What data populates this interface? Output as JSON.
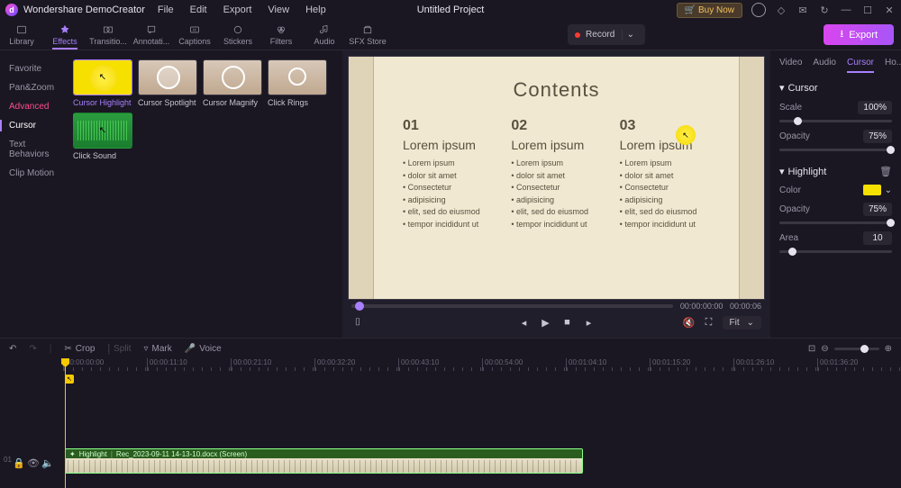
{
  "app": {
    "name": "Wondershare DemoCreator",
    "project": "Untitled Project"
  },
  "menu": [
    "File",
    "Edit",
    "Export",
    "View",
    "Help"
  ],
  "titlebar": {
    "buy": "🛒 Buy Now"
  },
  "tabs": [
    {
      "id": "library",
      "label": "Library"
    },
    {
      "id": "effects",
      "label": "Effects"
    },
    {
      "id": "transitions",
      "label": "Transitio..."
    },
    {
      "id": "annotations",
      "label": "Annotati..."
    },
    {
      "id": "captions",
      "label": "Captions"
    },
    {
      "id": "stickers",
      "label": "Stickers"
    },
    {
      "id": "filters",
      "label": "Filters"
    },
    {
      "id": "audio",
      "label": "Audio"
    },
    {
      "id": "sfx",
      "label": "SFX Store"
    }
  ],
  "record_label": "Record",
  "export_label": "Export",
  "sidebar": [
    "Favorite",
    "Pan&Zoom",
    "Advanced",
    "Cursor",
    "Text Behaviors",
    "Clip Motion"
  ],
  "effects": [
    {
      "id": "highlight",
      "label": "Cursor Highlight"
    },
    {
      "id": "spotlight",
      "label": "Cursor Spotlight"
    },
    {
      "id": "magnify",
      "label": "Cursor Magnify"
    },
    {
      "id": "rings",
      "label": "Click Rings"
    },
    {
      "id": "sound",
      "label": "Click Sound"
    }
  ],
  "doc": {
    "title": "Contents",
    "cols": [
      {
        "num": "01",
        "head": "Lorem ipsum",
        "items": [
          "Lorem ipsum",
          "dolor sit amet",
          "Consectetur",
          "adipisicing",
          "elit, sed do eiusmod",
          "tempor incididunt ut"
        ]
      },
      {
        "num": "02",
        "head": "Lorem ipsum",
        "items": [
          "Lorem ipsum",
          "dolor sit amet",
          "Consectetur",
          "adipisicing",
          "elit, sed do eiusmod",
          "tempor incididunt ut"
        ]
      },
      {
        "num": "03",
        "head": "Lorem ipsum",
        "items": [
          "Lorem ipsum",
          "dolor sit amet",
          "Consectetur",
          "adipisicing",
          "elit, sed do eiusmod",
          "tempor incididunt ut"
        ]
      }
    ]
  },
  "time": {
    "current": "00:00:00:00",
    "total": "00:00:06"
  },
  "fit": "Fit",
  "prop_tabs": [
    "Video",
    "Audio",
    "Cursor",
    "Ho..."
  ],
  "cursor_section": "Cursor",
  "highlight_section": "Highlight",
  "props": {
    "scale": {
      "label": "Scale",
      "value": "100%",
      "pct": 13
    },
    "opacity1": {
      "label": "Opacity",
      "value": "75%",
      "pct": 95
    },
    "color": {
      "label": "Color",
      "value": "#f5e000"
    },
    "opacity2": {
      "label": "Opacity",
      "value": "75%",
      "pct": 95
    },
    "area": {
      "label": "Area",
      "value": "10",
      "pct": 8
    }
  },
  "tl_tools": {
    "crop": "Crop",
    "split": "Split",
    "mark": "Mark",
    "voice": "Voice"
  },
  "ruler": [
    "00:00:00:00",
    "00:00:11:10",
    "00:00:21:10",
    "00:00:32:20",
    "00:00:43:10",
    "00:00:54:00",
    "00:01:04:10",
    "00:01:15:20",
    "00:01:26:10",
    "00:01:36:20"
  ],
  "clip": {
    "badge": "Highlight",
    "name": "Rec_2023-09-11 14-13-10.docx (Screen)"
  }
}
